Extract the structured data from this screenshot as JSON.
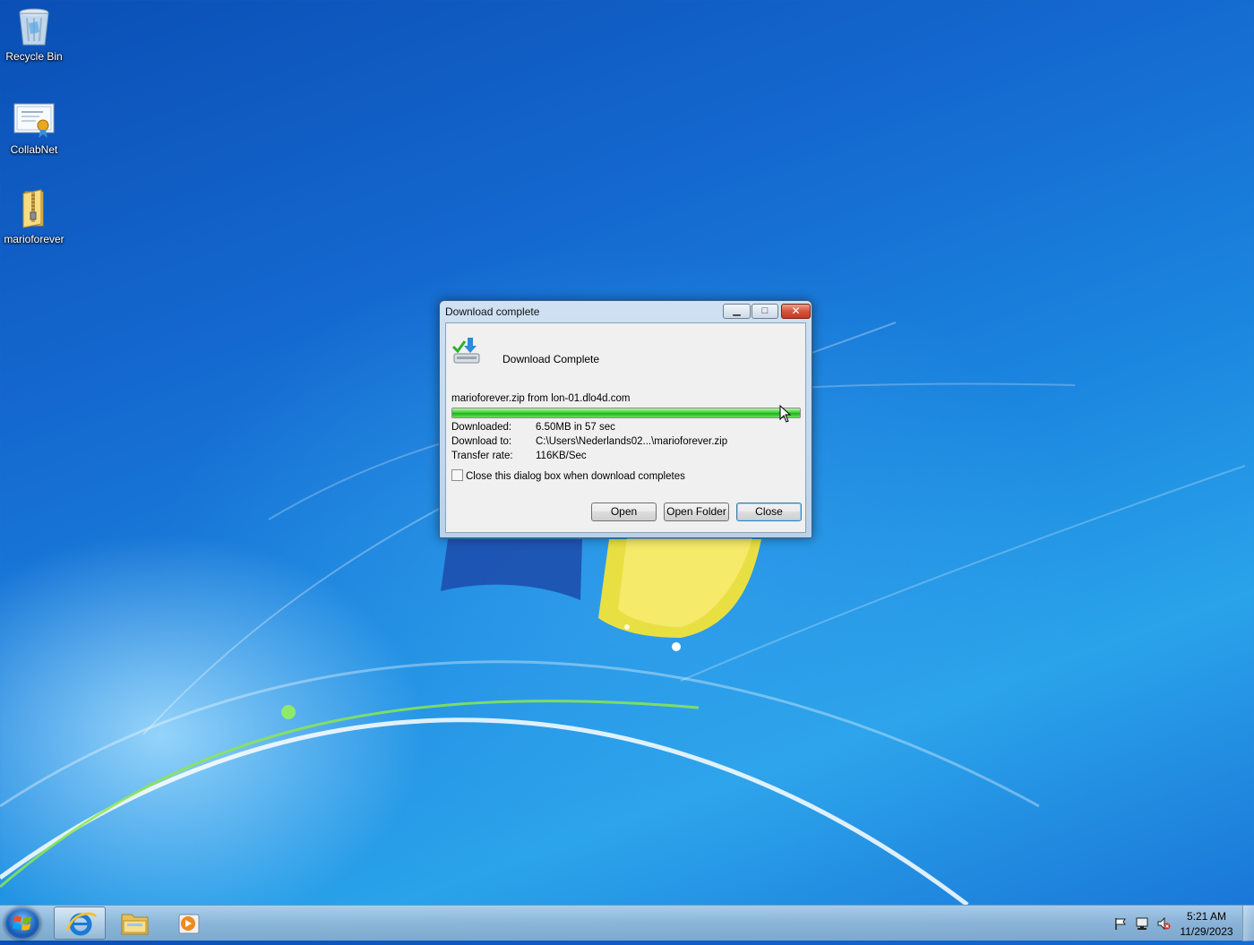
{
  "desktop": {
    "icons": [
      {
        "label": "Recycle Bin",
        "icon": "recycle-bin-icon"
      },
      {
        "label": "CollabNet",
        "icon": "certificate-icon"
      },
      {
        "label": "marioforever",
        "icon": "zip-folder-icon"
      }
    ]
  },
  "dialog": {
    "title": "Download complete",
    "header_text": "Download Complete",
    "source": "marioforever.zip from lon-01.dlo4d.com",
    "progress": 1.0,
    "details": [
      {
        "label": "Downloaded:",
        "value": "6.50MB in 57 sec"
      },
      {
        "label": "Download to:",
        "value": "C:\\Users\\Nederlands02...\\marioforever.zip"
      },
      {
        "label": "Transfer rate:",
        "value": "116KB/Sec"
      }
    ],
    "checkbox_label": "Close this dialog box when download completes",
    "checkbox_checked": false,
    "buttons": {
      "open": "Open",
      "open_folder": "Open Folder",
      "close": "Close"
    }
  },
  "taskbar": {
    "pinned": [
      "internet-explorer-icon",
      "file-explorer-icon",
      "media-player-icon"
    ],
    "tray": [
      "action-center-flag-icon",
      "network-icon",
      "volume-muted-icon"
    ],
    "time": "5:21 AM",
    "date": "11/29/2023"
  },
  "colors": {
    "progress_fill": "#1db21a",
    "close_button": "#c23a22",
    "desktop_blue": "#1468cf"
  }
}
